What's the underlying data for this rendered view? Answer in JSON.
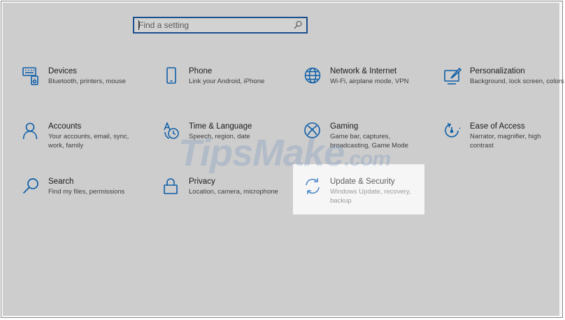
{
  "search": {
    "placeholder": "Find a setting"
  },
  "watermark": {
    "text": "TipsMake",
    "suffix": ".com"
  },
  "colors": {
    "accent": "#0e5ea8",
    "dim_overlay": "#cdcdcd",
    "highlight": "#f6f6f6"
  },
  "tiles": [
    {
      "title": "Devices",
      "desc": "Bluetooth, printers, mouse",
      "icon": "keyboard-speaker-icon"
    },
    {
      "title": "Phone",
      "desc": "Link your Android, iPhone",
      "icon": "phone-icon"
    },
    {
      "title": "Network & Internet",
      "desc": "Wi-Fi, airplane mode, VPN",
      "icon": "globe-icon"
    },
    {
      "title": "Personalization",
      "desc": "Background, lock screen, colors",
      "icon": "paint-icon"
    },
    {
      "title": "Accounts",
      "desc": "Your accounts, email, sync, work, family",
      "icon": "person-icon"
    },
    {
      "title": "Time & Language",
      "desc": "Speech, region, date",
      "icon": "time-language-icon"
    },
    {
      "title": "Gaming",
      "desc": "Game bar, captures, broadcasting, Game Mode",
      "icon": "xbox-icon"
    },
    {
      "title": "Ease of Access",
      "desc": "Narrator, magnifier, high contrast",
      "icon": "ease-of-access-icon"
    },
    {
      "title": "Search",
      "desc": "Find my files, permissions",
      "icon": "search-icon"
    },
    {
      "title": "Privacy",
      "desc": "Location, camera, microphone",
      "icon": "lock-icon"
    },
    {
      "title": "Update & Security",
      "desc": "Windows Update, recovery, backup",
      "icon": "sync-icon"
    }
  ]
}
